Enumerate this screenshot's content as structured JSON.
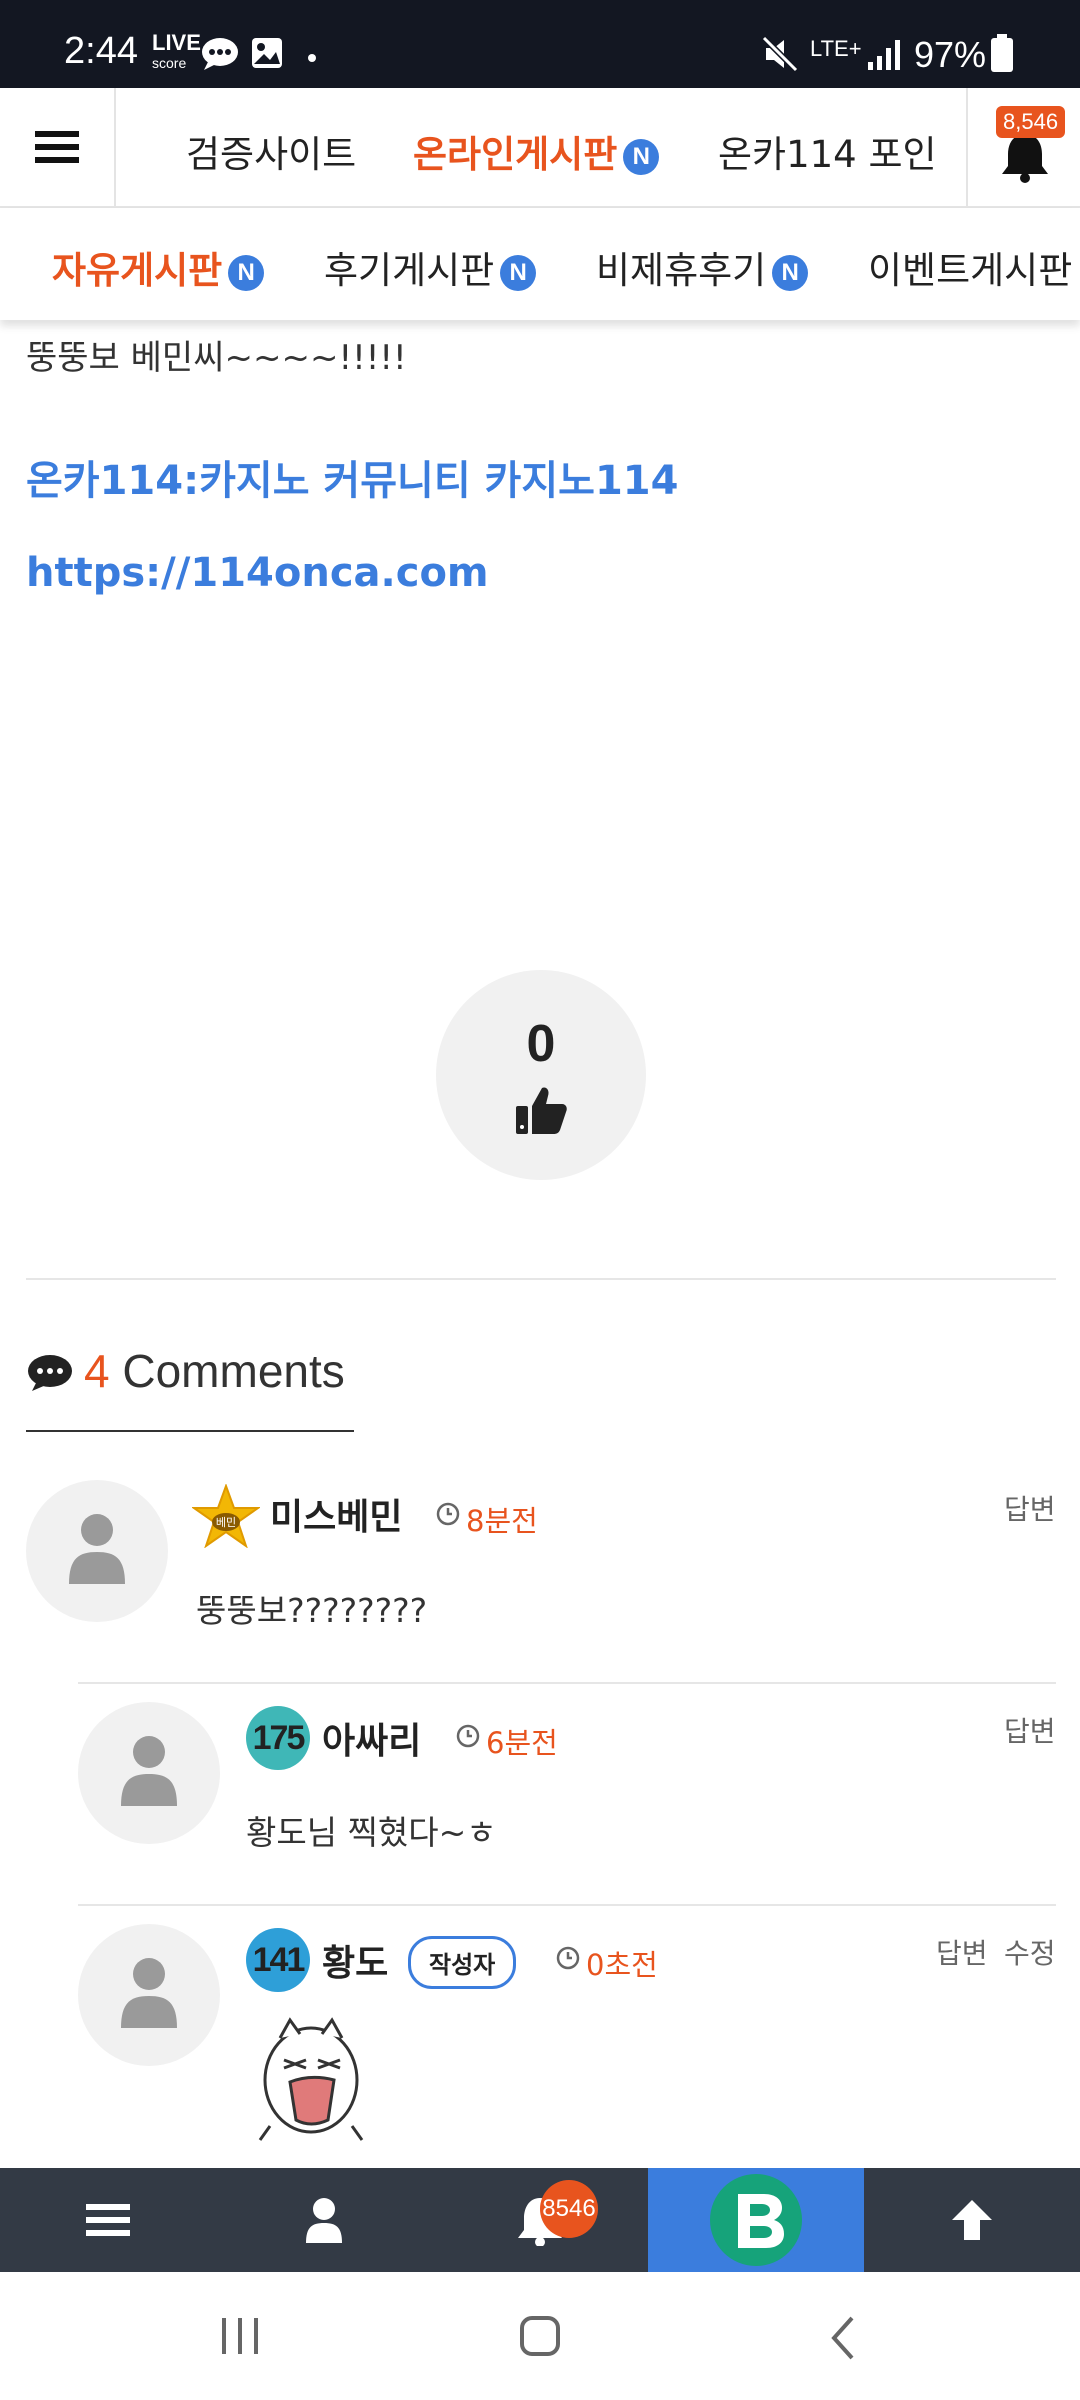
{
  "status_bar": {
    "time": "2:44",
    "network": "LTE+",
    "battery": "97%"
  },
  "top_nav": {
    "tabs": [
      {
        "label": "검증사이트",
        "new": false
      },
      {
        "label": "온라인게시판",
        "new": true
      },
      {
        "label": "온카114 포인"
      }
    ],
    "notification_count": "8,546"
  },
  "sub_nav": {
    "tabs": [
      {
        "label": "자유게시판",
        "new": true
      },
      {
        "label": "후기게시판",
        "new": true
      },
      {
        "label": "비제휴후기",
        "new": true
      },
      {
        "label": "이벤트게시판"
      }
    ],
    "new_badge": "N"
  },
  "post": {
    "text": "뚱뚱보 베민씨~~~~!!!!!",
    "link_title": "온카114:카지노 커뮤니티 카지노114",
    "link_url": "https://114onca.com",
    "likes": "0"
  },
  "comments_section": {
    "count": "4",
    "label": "Comments",
    "items": [
      {
        "level_badge": "베민",
        "name": "미스베민",
        "time": "8분전",
        "body": "뚱뚱보????????",
        "actions": [
          "답변"
        ]
      },
      {
        "level": "175",
        "name": "아싸리",
        "time": "6분전",
        "body": "황도님 찍혔다~ㅎ",
        "actions": [
          "답변"
        ]
      },
      {
        "level": "141",
        "name": "황도",
        "author_badge": "작성자",
        "time": "0초전",
        "actions": [
          "답변",
          "수정"
        ]
      }
    ]
  },
  "bottom_bar": {
    "notification_count": "8546"
  },
  "colors": {
    "accent": "#e8541e",
    "link": "#3b7ddd",
    "dark_bar": "#333a45"
  }
}
